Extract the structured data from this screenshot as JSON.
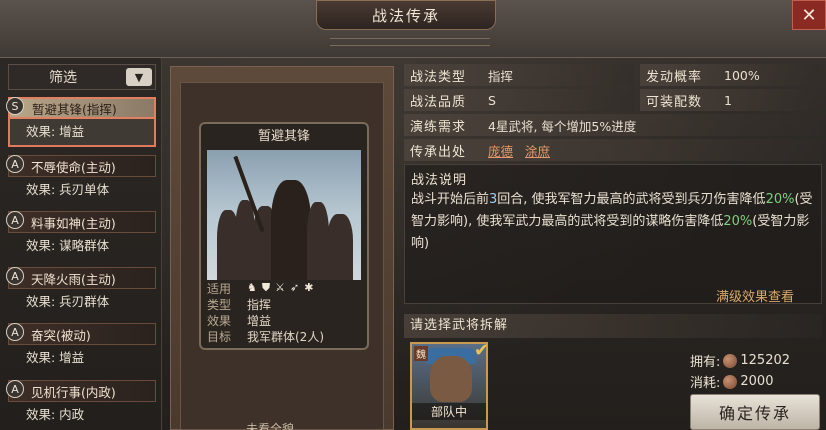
{
  "window": {
    "title": "战法传承",
    "close_label": "✕"
  },
  "filter": {
    "label": "筛选",
    "dropdown_icon": "chevron-down-icon"
  },
  "skill_list": [
    {
      "grade": "S",
      "name": "暂避其锋(指挥)",
      "effect": "效果: 增益",
      "selected": true
    },
    {
      "grade": "A",
      "name": "不辱使命(主动)",
      "effect": "效果: 兵刃单体",
      "selected": false
    },
    {
      "grade": "A",
      "name": "料事如神(主动)",
      "effect": "效果: 谋略群体",
      "selected": false
    },
    {
      "grade": "A",
      "name": "天降火雨(主动)",
      "effect": "效果: 兵刃群体",
      "selected": false
    },
    {
      "grade": "A",
      "name": "奋突(被动)",
      "effect": "效果: 增益",
      "selected": false
    },
    {
      "grade": "A",
      "name": "见机行事(内政)",
      "effect": "效果: 内政",
      "selected": false
    }
  ],
  "card": {
    "title": "暂避其锋",
    "meta": [
      {
        "key": "适用",
        "value": ""
      },
      {
        "key": "类型",
        "value": "指挥"
      },
      {
        "key": "效果",
        "value": "增益"
      },
      {
        "key": "目标",
        "value": "我军群体(2人)"
      }
    ],
    "applicable_icons": [
      "cavalry-icon",
      "shield-icon",
      "crossed-swords-icon",
      "bow-icon",
      "wheel-icon"
    ]
  },
  "scroll_footer": "未看全貌",
  "info": {
    "type_label": "战法类型",
    "type_value": "指挥",
    "rate_label": "发动概率",
    "rate_value": "100%",
    "quality_label": "战法品质",
    "quality_value": "S",
    "equip_label": "可装配数",
    "equip_value": "1",
    "req_label": "演练需求",
    "req_value": "4星武将, 每个增加5%进度",
    "origin_label": "传承出处",
    "origin_links": [
      "庞德",
      "涂庶"
    ]
  },
  "description": {
    "heading": "战法说明",
    "parts": [
      {
        "text": "战斗开始后前",
        "cls": ""
      },
      {
        "text": "3",
        "cls": "hl-num"
      },
      {
        "text": "回合, 使我军智力最高的武将受到兵刃伤害降低",
        "cls": ""
      },
      {
        "text": "20%",
        "cls": "hl-green"
      },
      {
        "text": "(受智力影响), 使我军武力最高的武将受到的谋略伤害降低",
        "cls": ""
      },
      {
        "text": "20%",
        "cls": "hl-green"
      },
      {
        "text": "(受智力影响)",
        "cls": ""
      }
    ],
    "max_effect_link": "满级效果查看"
  },
  "pick": {
    "label": "请选择武将拆解",
    "general": {
      "faction": "魏",
      "name": "部队中"
    }
  },
  "resources": {
    "own_label": "拥有:",
    "own_value": "125202",
    "cost_label": "消耗:",
    "cost_value": "2000"
  },
  "confirm_label": "确定传承",
  "colors": {
    "accent_red": "#e07a5e",
    "link_orange": "#e89a6a",
    "highlight_green": "#7ed080"
  }
}
